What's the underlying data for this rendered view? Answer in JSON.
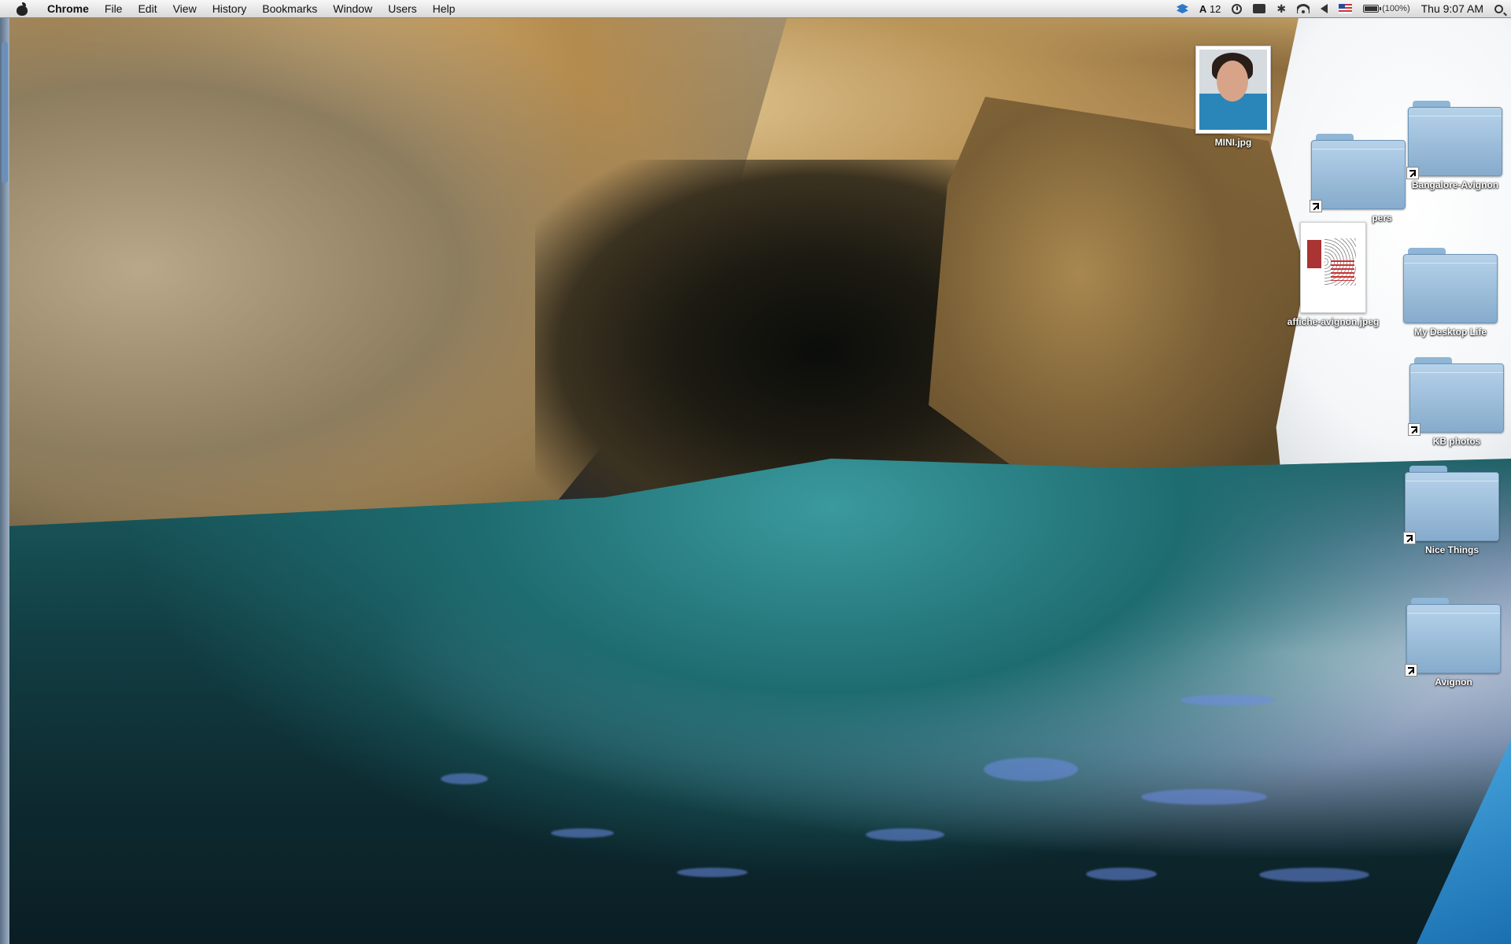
{
  "menubar": {
    "app_name": "Chrome",
    "items": [
      "File",
      "Edit",
      "View",
      "History",
      "Bookmarks",
      "Window",
      "Users",
      "Help"
    ],
    "status": {
      "adobe_count": "12",
      "battery": "(100%)",
      "clock": "Thu 9:07 AM"
    }
  },
  "desktop": {
    "icons": [
      {
        "label": "MINI.jpg",
        "type": "image"
      },
      {
        "label": "Bangalore-Avignon",
        "type": "folder-alias"
      },
      {
        "label": "pers",
        "type": "folder-alias"
      },
      {
        "label": "affiche-avignon.jpeg",
        "type": "image"
      },
      {
        "label": "My Desktop Life",
        "type": "folder"
      },
      {
        "label": "KB photos",
        "type": "folder-alias"
      },
      {
        "label": "Nice Things",
        "type": "folder-alias"
      },
      {
        "label": "Avignon",
        "type": "folder-alias"
      }
    ]
  },
  "colors": {
    "menubar": "#e6e6e6",
    "folder": "#a9c7e3",
    "water": "#1a5d62"
  }
}
